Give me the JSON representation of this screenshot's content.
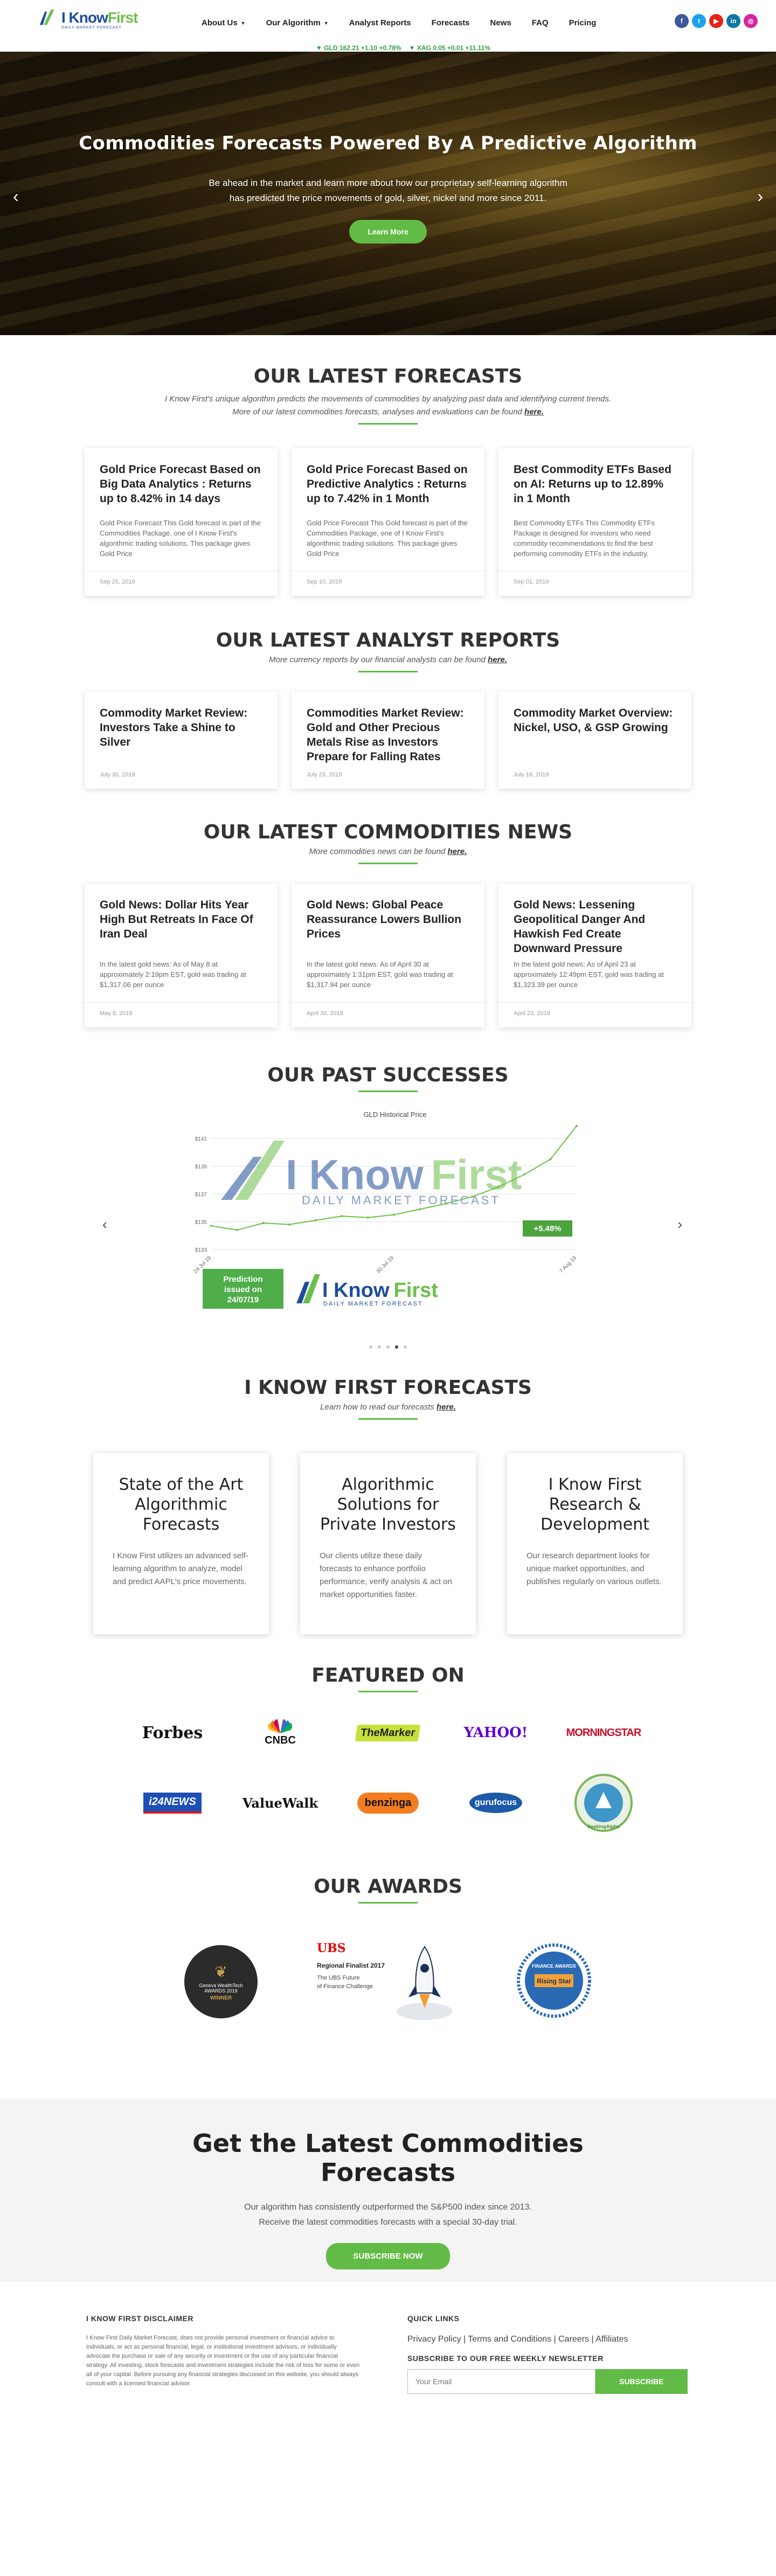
{
  "header": {
    "logo_text_1": "I Know",
    "logo_text_2": "First",
    "logo_sub": "DAILY MARKET FORECAST",
    "nav": [
      "About Us",
      "Our Algorithm",
      "Analyst Reports",
      "Forecasts",
      "News",
      "FAQ",
      "Pricing"
    ],
    "social_icons": [
      "facebook-icon",
      "twitter-icon",
      "youtube-icon",
      "linkedin-icon",
      "instagram-icon"
    ],
    "ticker": [
      "▼ GLD 162.21 +1.10 +0.78%",
      "▼ XAG 0.05 +0.01 +11.11%"
    ]
  },
  "hero": {
    "title": "Commodities Forecasts Powered By A Predictive Algorithm",
    "text": "Be ahead in the market and learn more about how our proprietary self-learning algorithm has predicted the price movements of gold, silver, nickel and more since 2011.",
    "button": "Learn More"
  },
  "forecasts": {
    "title": "OUR LATEST FORECASTS",
    "sub_1": "I Know First's unique algorithm predicts the movements of commodities by analyzing past data and identifying current trends. More of our latest commodities forecasts, analyses and evaluations can be found",
    "sub_link": "here.",
    "cards": [
      {
        "title": "Gold Price Forecast Based on Big Data Analytics : Returns up to 8.42% in 14 days",
        "text": "Gold Price Forecast This Gold forecast is part of the Commodities Package, one of I Know First's algorithmic trading solutions. This package gives Gold Price",
        "date": "Sep 25, 2019"
      },
      {
        "title": "Gold Price Forecast Based on Predictive Analytics : Returns up to 7.42% in 1 Month",
        "text": "Gold Price Forecast This Gold forecast is part of the Commodities Package, one of I Know First's algorithmic trading solutions. This package gives Gold Price",
        "date": "Sep 10, 2019"
      },
      {
        "title": "Best Commodity ETFs Based on AI: Returns up to 12.89% in 1 Month",
        "text": "Best Commodity ETFs This Commodity ETFs Package is designed for investors who need commodity recommendations to find the best performing commodity ETFs in the industry.",
        "date": "Sep 01, 2019"
      }
    ]
  },
  "reports": {
    "title": "OUR LATEST ANALYST REPORTS",
    "sub": "More currency reports by our financial analysts can be found",
    "sub_link": "here.",
    "cards": [
      {
        "title": "Commodity Market Review: Investors Take a Shine to Silver",
        "date": "July 30, 2019"
      },
      {
        "title": "Commodities Market Review: Gold and Other Precious Metals Rise as Investors Prepare for Falling Rates",
        "date": "July 23, 2019"
      },
      {
        "title": "Commodity Market Overview: Nickel, USO, & GSP Growing",
        "date": "July 16, 2019"
      }
    ]
  },
  "news": {
    "title": "OUR LATEST COMMODITIES NEWS",
    "sub": "More commodities news can be found",
    "sub_link": "here.",
    "cards": [
      {
        "title": "Gold News: Dollar Hits Year High But Retreats In Face Of Iran Deal",
        "text": "In the latest gold news: As of May 8 at approximately 2:19pm EST, gold was trading at $1,317.06 per ounce",
        "date": "May 8, 2018"
      },
      {
        "title": "Gold News: Global Peace Reassurance Lowers Bullion Prices",
        "text": "In the latest gold news: As of April 30 at approximately 1:31pm EST, gold was trading at $1,317.94 per ounce",
        "date": "April 30, 2018"
      },
      {
        "title": "Gold News: Lessening Geopolitical Danger And Hawkish Fed Create Downward Pressure",
        "text": "In the latest gold news: As of April 23 at approximately 12:49pm EST, gold was trading at $1,323.39 per ounce",
        "date": "April 23, 2018"
      }
    ]
  },
  "successes": {
    "title": "OUR PAST SUCCESSES",
    "badge_line_1": "Prediction",
    "badge_line_2": "issued on",
    "badge_line_3": "24/07/19",
    "watermark_1": "I Know",
    "watermark_2": "First",
    "watermark_sub": "DAILY MARKET FORECAST"
  },
  "chart_data": {
    "type": "line",
    "title": "GLD Historical Price",
    "x": [
      "24 Jul 19",
      "",
      "",
      "",
      "",
      "",
      "",
      "30 Jul 19",
      "",
      "",
      "",
      "",
      "",
      "",
      "7 Aug 19"
    ],
    "series": [
      {
        "values": [
          134.7,
          134.4,
          134.9,
          134.8,
          135.1,
          135.4,
          135.3,
          135.5,
          135.9,
          136.3,
          136.8,
          137.5,
          138.4,
          139.5,
          141.9
        ]
      }
    ],
    "y_ticks": [
      "$141",
      "$139",
      "$137",
      "$135",
      "$133"
    ],
    "ylim": [
      133,
      142
    ],
    "return_label": "+5.48%",
    "grid": true
  },
  "how_to": {
    "title": "I KNOW FIRST FORECASTS",
    "sub": "Learn how to read our forecasts",
    "sub_link": "here.",
    "boxes": [
      {
        "title": "State of the Art Algorithmic Forecasts",
        "text": "I Know First utilizes an advanced self-learning algorithm to analyze, model and predict AAPL's price movements."
      },
      {
        "title": "Algorithmic Solutions for Private Investors",
        "text": "Our clients utilize these daily forecasts to enhance portfolio performance, verify analysis & act on market opportunities faster."
      },
      {
        "title": "I Know First Research & Development",
        "text": "Our research department looks for unique market opportunities, and publishes regularly on various outlets."
      }
    ]
  },
  "featured": {
    "title": "FEATURED ON",
    "row1": [
      "Forbes",
      "CNBC",
      "TheMarker",
      "YAHOO!",
      "MORNINGSTAR"
    ],
    "row2": [
      "i24NEWS",
      "ValueWalk",
      "benzinga",
      "gurufocus",
      "SeekingAlpha"
    ]
  },
  "awards": {
    "title": "OUR AWARDS",
    "a1_line1": "Geneva WealthTech",
    "a1_line2": "AWARDS 2019",
    "a1_line3": "WINNER",
    "a2_brand": "UBS",
    "a2_line1": "Regional Finalist 2017",
    "a2_line2": "The UBS Future",
    "a2_line3": "of Finance Challenge",
    "a3_line1": "FINANCE AWARDS",
    "a3_line2": "Rising Star"
  },
  "cta": {
    "title_1": "Get the Latest Commodities",
    "title_2": "Forecasts",
    "line_1": "Our algorithm has consistently outperformed the S&P500 index since 2013.",
    "line_2": "Receive the latest commodities forecasts with a special 30-day trial.",
    "button": "SUBSCRIBE NOW"
  },
  "footer": {
    "disclaimer_title": "I KNOW FIRST DISCLAIMER",
    "disclaimer": "I Know First Daily Market Forecast, does not provide personal investment or financial advice to individuals, or act as personal financial, legal, or institutional investment advisors, or individually advocate the purchase or sale of any security or investment or the use of any particular financial strategy. All investing, stock forecasts and investment strategies include the risk of loss for some or even all of your capital. Before pursuing any financial strategies discussed on this website, you should always consult with a licensed financial advisor.",
    "links_title": "QUICK LINKS",
    "links": "Privacy Policy | Terms and Conditions | Careers | Affiliates",
    "newsletter_title": "SUBSCRIBE TO OUR FREE WEEKLY NEWSLETTER",
    "email_placeholder": "Your Email",
    "subscribe": "SUBSCRIBE"
  },
  "colors": {
    "accent": "#62bb46",
    "brand_blue": "#1e4d9b",
    "ticker_green": "#2f9e44"
  }
}
